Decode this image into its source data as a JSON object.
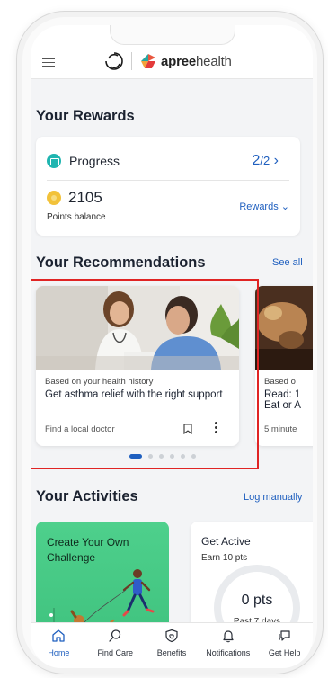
{
  "header": {
    "logo_bold": "apree",
    "logo_light": "health"
  },
  "rewards": {
    "section_title": "Your Rewards",
    "progress_label": "Progress",
    "progress_current": "2",
    "progress_total": "/2",
    "points_value": "2105",
    "points_label": "Points balance",
    "rewards_link": "Rewards"
  },
  "recommendations": {
    "section_title": "Your Recommendations",
    "see_all": "See all",
    "cards": [
      {
        "subtitle": "Based on your health history",
        "title": "Get asthma relief with the right support",
        "footer": "Find a local doctor"
      },
      {
        "subtitle": "Based o",
        "title": "Read: 1 Eat or A",
        "footer": "5 minute"
      }
    ],
    "carousel_count": 6,
    "carousel_active": 0
  },
  "activities": {
    "section_title": "Your Activities",
    "log_manually": "Log manually",
    "challenge_title": "Create Your Own Challenge",
    "active_title": "Get Active",
    "active_sub": "Earn 10 pts",
    "points": "0 pts",
    "period": "Past 7 days",
    "progress_fraction": 0
  },
  "nav": {
    "items": [
      {
        "label": "Home",
        "icon": "home-icon"
      },
      {
        "label": "Find Care",
        "icon": "search-icon"
      },
      {
        "label": "Benefits",
        "icon": "shield-icon"
      },
      {
        "label": "Notifications",
        "icon": "bell-icon"
      },
      {
        "label": "Get Help",
        "icon": "chat-icon"
      }
    ]
  },
  "colors": {
    "accent": "#1f5fbf",
    "teal": "#1fb5b0",
    "green": "#4ed08c",
    "coin": "#f2c23a",
    "highlight": "#e02424"
  }
}
